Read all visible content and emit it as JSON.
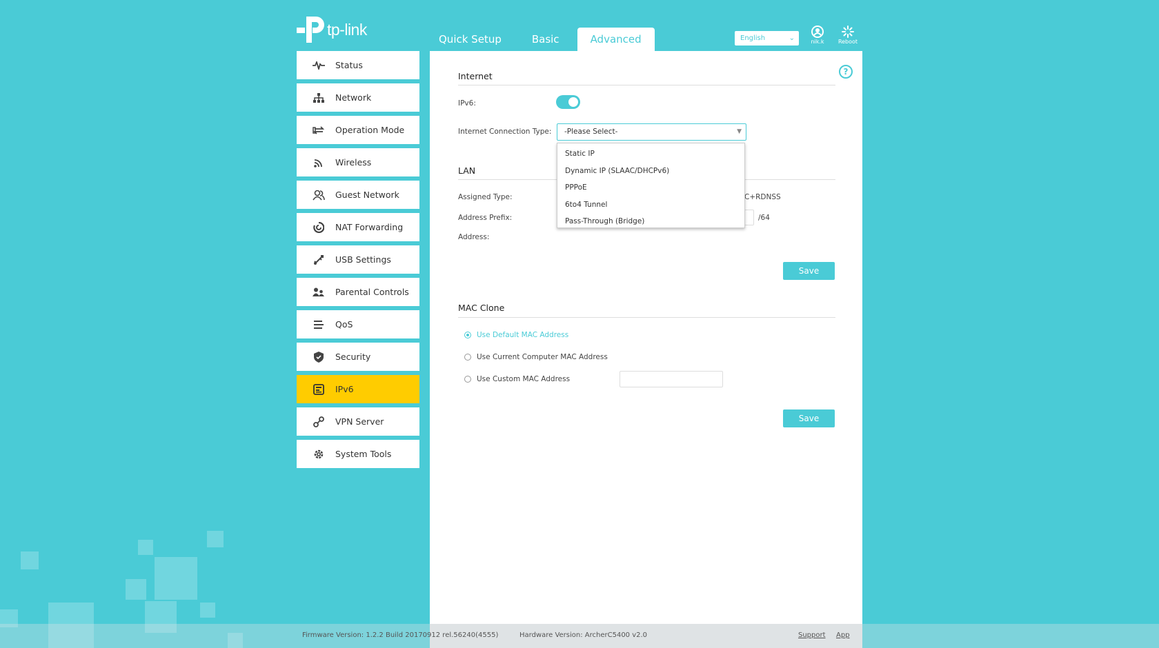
{
  "brand": {
    "name": "tp-link"
  },
  "topnav": {
    "tabs": [
      {
        "label": "Quick Setup"
      },
      {
        "label": "Basic"
      },
      {
        "label": "Advanced"
      }
    ]
  },
  "header": {
    "language": "English",
    "user_label": "nik.k",
    "reboot_label": "Reboot"
  },
  "sidebar": {
    "items": [
      {
        "label": "Status",
        "icon": "pulse-icon"
      },
      {
        "label": "Network",
        "icon": "network-icon"
      },
      {
        "label": "Operation Mode",
        "icon": "operation-mode-icon"
      },
      {
        "label": "Wireless",
        "icon": "wifi-icon"
      },
      {
        "label": "Guest Network",
        "icon": "guest-users-icon"
      },
      {
        "label": "NAT Forwarding",
        "icon": "nat-icon"
      },
      {
        "label": "USB Settings",
        "icon": "usb-icon"
      },
      {
        "label": "Parental Controls",
        "icon": "parental-icon"
      },
      {
        "label": "QoS",
        "icon": "qos-icon"
      },
      {
        "label": "Security",
        "icon": "shield-icon"
      },
      {
        "label": "IPv6",
        "icon": "ipv6-icon"
      },
      {
        "label": "VPN Server",
        "icon": "vpn-icon"
      },
      {
        "label": "System Tools",
        "icon": "gear-icon"
      }
    ],
    "active": "IPv6"
  },
  "internet": {
    "title": "Internet",
    "ipv6_label": "IPv6:",
    "ipv6_enabled": true,
    "conn_type_label": "Internet Connection Type:",
    "conn_type_value": "-Please Select-",
    "options": [
      "Static IP",
      "Dynamic IP (SLAAC/DHCPv6)",
      "PPPoE",
      "6to4 Tunnel",
      "Pass-Through (Bridge)"
    ]
  },
  "lan": {
    "title": "LAN",
    "assigned_type_label": "Assigned Type:",
    "assigned_type_value_partial": "C+RDNSS",
    "address_prefix_label": "Address Prefix:",
    "prefix_suffix": "/64",
    "address_label": "Address:",
    "save_label": "Save"
  },
  "mac_clone": {
    "title": "MAC Clone",
    "options": [
      {
        "label": "Use Default MAC Address",
        "selected": true
      },
      {
        "label": "Use Current Computer MAC Address",
        "selected": false
      },
      {
        "label": "Use Custom MAC Address",
        "selected": false
      }
    ],
    "save_label": "Save"
  },
  "footer": {
    "firmware": "Firmware Version: 1.2.2 Build 20170912 rel.56240(4555)",
    "hardware": "Hardware Version: ArcherC5400 v2.0",
    "support_label": "Support",
    "app_label": "App"
  },
  "colors": {
    "accent": "#4acbd6",
    "active_item": "#ffcc00"
  }
}
